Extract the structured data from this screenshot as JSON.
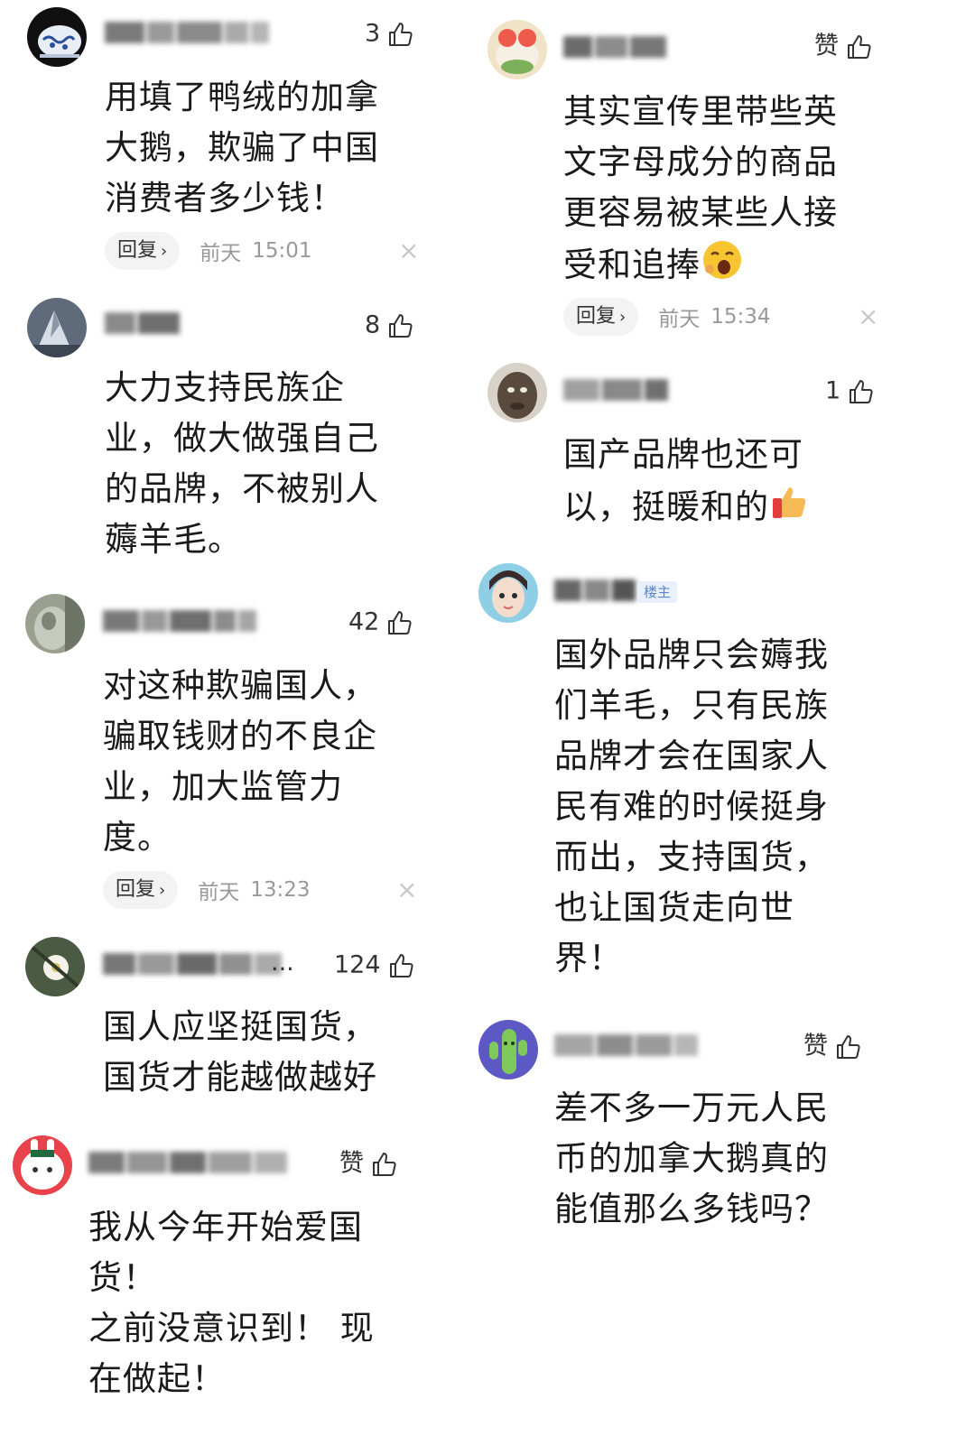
{
  "ui": {
    "reply_label": "回复",
    "reply_chevron": "›",
    "day_label": "前天",
    "like_label": "赞",
    "close_glyph": "×"
  },
  "comments_left": [
    {
      "likes": "3",
      "text": "用填了鸭绒的加拿\n大鹅，欺骗了中国\n消费者多少钱！",
      "time": "15:01"
    },
    {
      "likes": "8",
      "text": "大力支持民族企\n业，做大做强自己\n的品牌，不被别人\n薅羊毛。"
    },
    {
      "likes": "42",
      "text": "对这种欺骗国人，\n骗取钱财的不良企\n业，加大监管力\n度。",
      "time": "13:23"
    },
    {
      "likes": "124",
      "username_ellipsis": "...",
      "text": "国人应坚挺国货，\n国货才能越做越好"
    },
    {
      "likes": "赞",
      "text": "我从今年开始爱国\n货！\n之前没意识到！ 现\n在做起！"
    }
  ],
  "comments_right": [
    {
      "likes": "赞",
      "text": "其实宣传里带些英\n文字母成分的商品\n更容易被某些人接\n受和追捧",
      "emoji": "yawning-face-emoji",
      "time": "15:34"
    },
    {
      "likes": "1",
      "text": "国产品牌也还可\n以，挺暖和的",
      "emoji": "thumbs-up-emoji"
    },
    {
      "badge": "楼主",
      "text": "国外品牌只会薅我\n们羊毛，只有民族\n品牌才会在国家人\n民有难的时候挺身\n而出，支持国货，\n也让国货走向世\n界！"
    },
    {
      "likes": "赞",
      "text": "差不多一万元人民\n币的加拿大鹅真的\n能值那么多钱吗？"
    }
  ],
  "icons": {
    "like": "thumbs-up-outline-icon",
    "close": "close-icon",
    "chevron": "chevron-right-icon"
  },
  "colors": {
    "text": "#1a1a1a",
    "meta": "#999999",
    "reply_bg": "#f3f3f3",
    "badge_text": "#5a86c8",
    "badge_bg": "#e8f0fb"
  }
}
